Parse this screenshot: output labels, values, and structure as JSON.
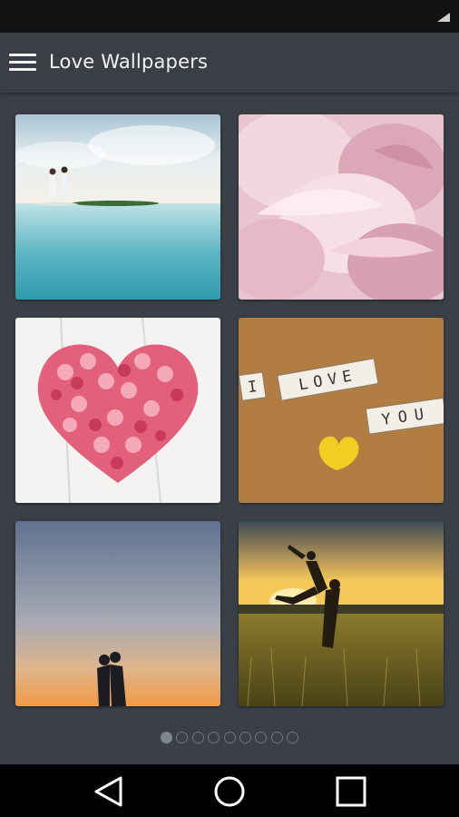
{
  "app": {
    "title": "Love Wallpapers"
  },
  "wallpapers": [
    {
      "name": "Couple on a sandbar"
    },
    {
      "name": "Pink peony petals"
    },
    {
      "name": "Heart of pink roses"
    },
    {
      "name": "I love you tiles"
    },
    {
      "name": "Silhouette kiss at dusk"
    },
    {
      "name": "Couple leaping in wheat field at sunset"
    }
  ],
  "tile_text": {
    "word_i": "I",
    "word_love": "LOVE",
    "word_you": "YOU"
  },
  "pager": {
    "pages": 9,
    "current": 1
  },
  "nav": {
    "back": "back-icon",
    "home": "home-icon",
    "recents": "recents-icon"
  },
  "colors": {
    "background": "#3b4048",
    "app_bar": "#3a3f46",
    "status_bar": "#0f1113",
    "nav_bar": "#000000"
  }
}
